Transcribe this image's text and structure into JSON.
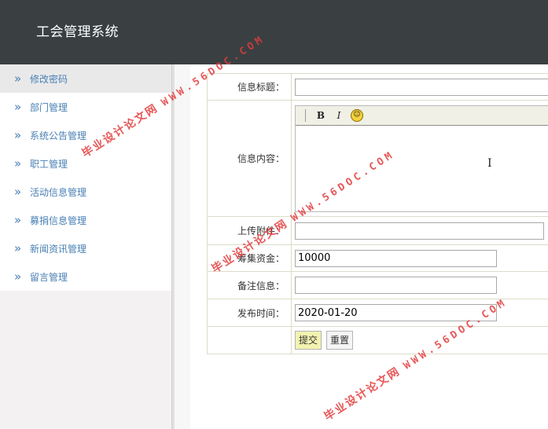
{
  "app": {
    "title": "工会管理系统"
  },
  "sidebar": {
    "items": [
      {
        "label": "修改密码",
        "active": true
      },
      {
        "label": "部门管理"
      },
      {
        "label": "系统公告管理"
      },
      {
        "label": "职工管理"
      },
      {
        "label": "活动信息管理"
      },
      {
        "label": "募捐信息管理"
      },
      {
        "label": "新闻资讯管理"
      },
      {
        "label": "留言管理"
      }
    ],
    "chevron": "»"
  },
  "form": {
    "title_label": "信息标题：",
    "title_value": "",
    "content_label": "信息内容：",
    "editor_toolbar": {
      "bold": "B",
      "italic": "I",
      "emoticon": "☺"
    },
    "attachment_label": "上传附件：",
    "attachment_value": "",
    "funds_label": "筹集资金：",
    "funds_value": "10000",
    "remarks_label": "备注信息：",
    "remarks_value": "",
    "publish_time_label": "发布时间：",
    "publish_time_value": "2020-01-20",
    "submit_label": "提交",
    "reset_label": "重置"
  },
  "watermark": {
    "cn": "毕业设计论文网",
    "en": "WWW.56DOC.COM"
  },
  "colors": {
    "header_bg": "#3a4042",
    "sidebar_link": "#4a80b4",
    "submit_bg": "#f2f2b0",
    "watermark": "#e23c3c"
  }
}
